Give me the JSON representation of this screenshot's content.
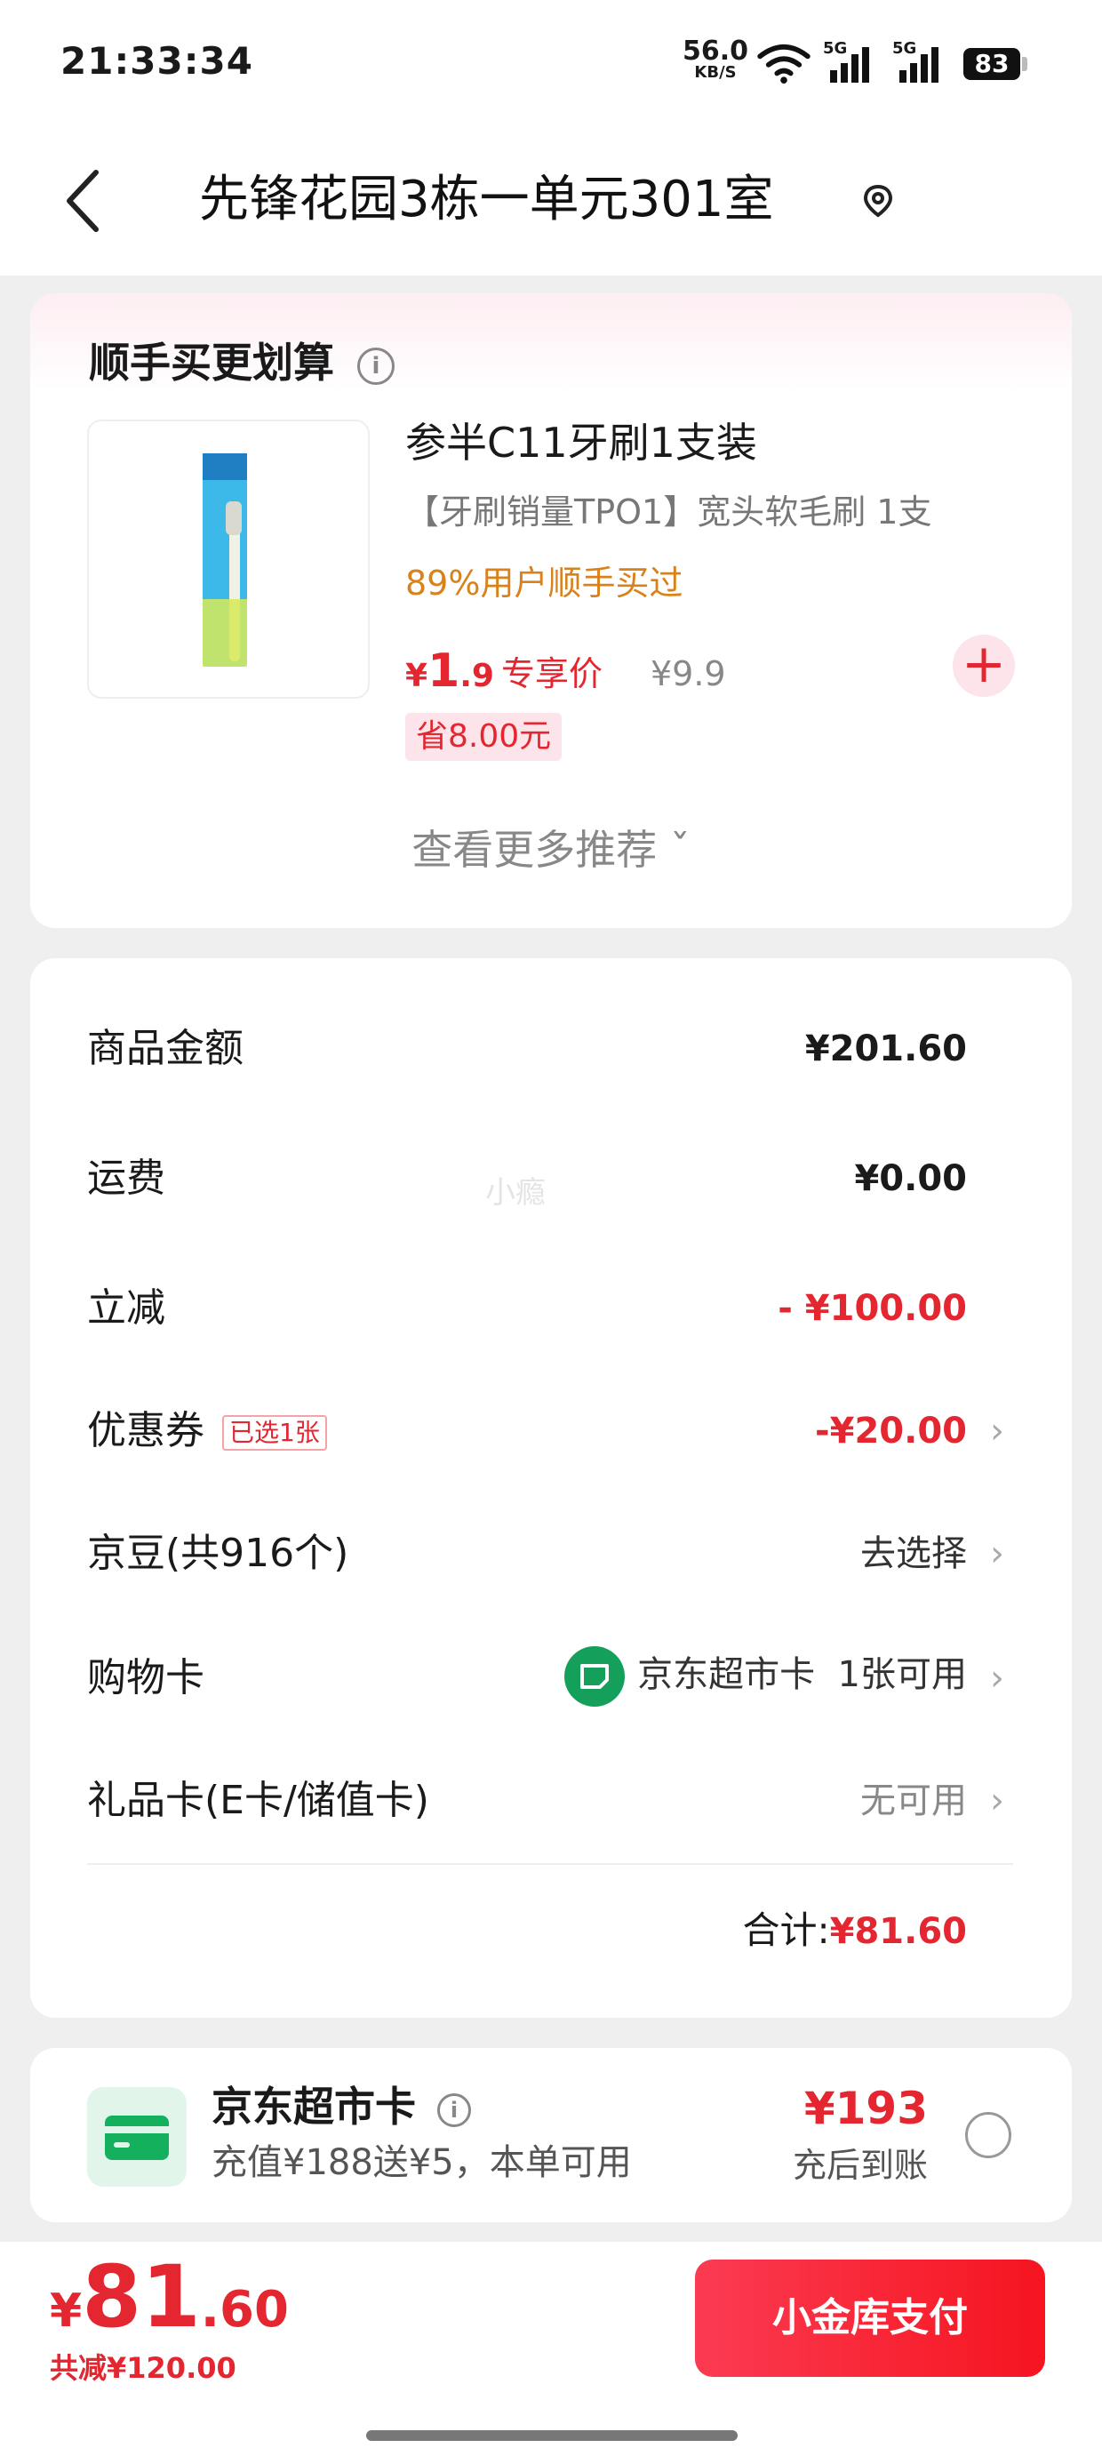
{
  "status_bar": {
    "time": "21:33:34",
    "net_speed": "56.0",
    "net_unit": "KB/S",
    "sig1_label": "5G",
    "sig2_label": "5G",
    "battery": "83"
  },
  "header": {
    "address": "先锋花园3栋一单元301室",
    "back_icon": "chevron-left-icon",
    "location_icon": "location-pin-icon"
  },
  "upsell": {
    "title": "顺手买更划算",
    "info_icon": "i",
    "product": {
      "name": "参半C11牙刷1支装",
      "description": "【牙刷销量TPO1】宽头软毛刷 1支",
      "rate": "89%用户顺手买过",
      "price_symbol": "¥",
      "price_int": "1",
      "price_dec": ".9",
      "exclusive_label": "专享价",
      "original_price": "¥9.9",
      "save_label": "省8.00元",
      "add_label": "+"
    },
    "more_label": "查看更多推荐 ˇ"
  },
  "summary": {
    "goods_label": "商品金额",
    "goods_value": "¥201.60",
    "shipping_label": "运费",
    "shipping_value": "¥0.00",
    "instant_label": "立减",
    "instant_value": "- ¥100.00",
    "coupon_label": "优惠券",
    "coupon_tag": "已选1张",
    "coupon_value": "-¥20.00",
    "beans_label": "京豆(共916个)",
    "beans_value": "去选择",
    "shopcard_label": "购物卡",
    "shopcard_name": "京东超市卡",
    "shopcard_value": "1张可用",
    "giftcard_label": "礼品卡(E卡/储值卡)",
    "giftcard_value": "无可用",
    "total_label": "合计:",
    "total_value": "¥81.60",
    "watermark": "小瘾",
    "chevron": "›"
  },
  "supermarket_card": {
    "title": "京东超市卡",
    "subtitle": "充值¥188送¥5，本单可用",
    "price": "¥193",
    "note": "充后到账",
    "info_icon": "i"
  },
  "bottom_bar": {
    "symbol": "¥",
    "total_int": "81",
    "total_dec": ".60",
    "reduced": "共减¥120.00",
    "pay_label": "小金库支付"
  },
  "colors": {
    "accent_red": "#e3262f",
    "orange": "#d9811a",
    "green": "#14a05a"
  }
}
